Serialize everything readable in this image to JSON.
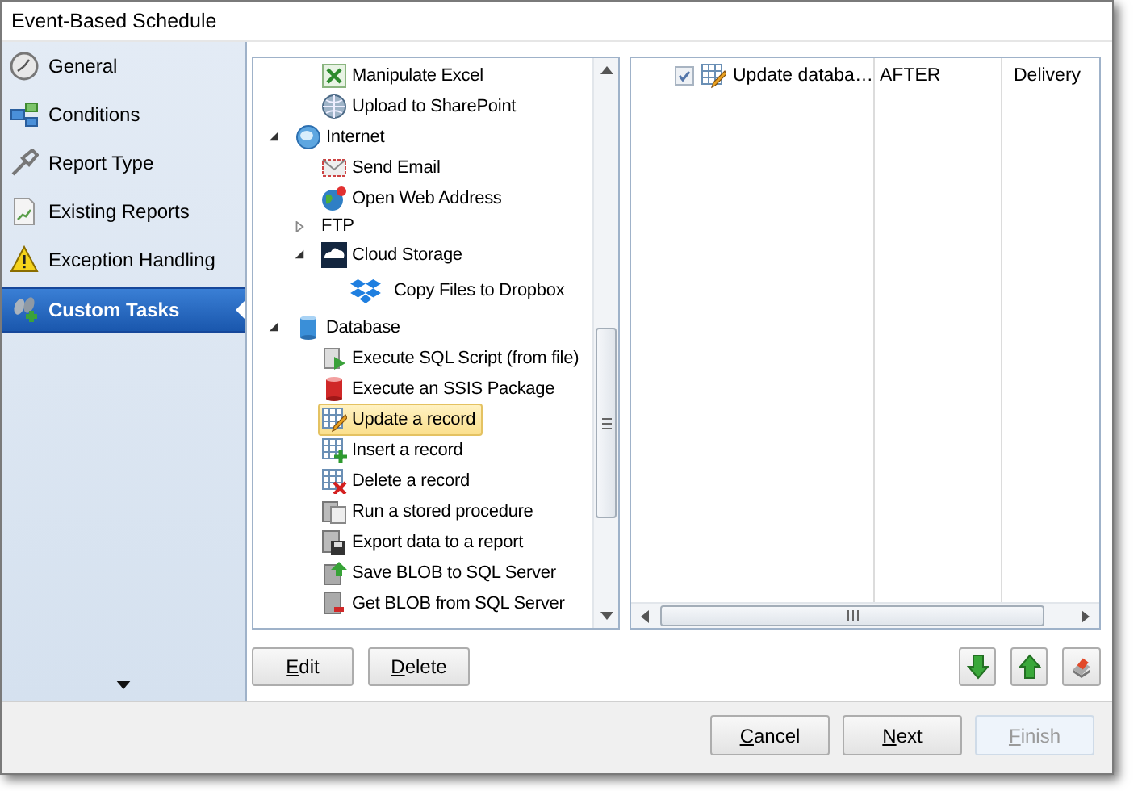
{
  "window": {
    "title": "Event-Based Schedule"
  },
  "sidebar": {
    "items": [
      {
        "label": "General",
        "kind": "clock",
        "selected": false
      },
      {
        "label": "Conditions",
        "kind": "conditions",
        "selected": false
      },
      {
        "label": "Report Type",
        "kind": "report-type",
        "selected": false
      },
      {
        "label": "Existing Reports",
        "kind": "document",
        "selected": false
      },
      {
        "label": "Exception Handling",
        "kind": "warning",
        "selected": false
      },
      {
        "label": "Custom Tasks",
        "kind": "tasks",
        "selected": true
      }
    ]
  },
  "tree": {
    "continued_items": [
      {
        "label": "Manipulate Excel",
        "kind": "excel",
        "selected": false
      },
      {
        "label": "Upload to SharePoint",
        "kind": "sharepoint",
        "selected": false
      }
    ],
    "items": [
      {
        "label": "Internet",
        "kind": "globe",
        "expanded": true,
        "selected": false,
        "children": [
          {
            "label": "Send Email",
            "kind": "mail",
            "selected": false
          },
          {
            "label": "Open Web Address",
            "kind": "web",
            "selected": false
          },
          {
            "label": "FTP",
            "kind": "plain",
            "expanded": false,
            "selected": false
          },
          {
            "label": "Cloud Storage",
            "kind": "cloud",
            "expanded": true,
            "selected": false,
            "children": [
              {
                "label": "Copy Files to Dropbox",
                "kind": "dropbox",
                "selected": false
              }
            ]
          }
        ]
      },
      {
        "label": "Database",
        "kind": "database",
        "expanded": true,
        "selected": false,
        "children": [
          {
            "label": "Execute SQL Script (from file)",
            "kind": "script",
            "selected": false
          },
          {
            "label": "Execute an SSIS Package",
            "kind": "package",
            "selected": false
          },
          {
            "label": "Update a record",
            "kind": "table-edit",
            "selected": true
          },
          {
            "label": "Insert a record",
            "kind": "table-add",
            "selected": false
          },
          {
            "label": "Delete a record",
            "kind": "table-delete",
            "selected": false
          },
          {
            "label": "Run a stored procedure",
            "kind": "procedure",
            "selected": false
          },
          {
            "label": "Export data to a report",
            "kind": "export",
            "selected": false
          },
          {
            "label": "Save BLOB to SQL Server",
            "kind": "blob-save",
            "selected": false
          },
          {
            "label": "Get BLOB from SQL Server",
            "kind": "blob-get",
            "selected": false
          }
        ]
      }
    ]
  },
  "tasks": [
    {
      "checked": true,
      "kind": "table-edit",
      "name": "Update databa…",
      "column_2": "AFTER",
      "column_3": "Delivery"
    }
  ],
  "task_buttons": [
    {
      "label": "Edit"
    },
    {
      "label": "Delete"
    }
  ],
  "footer_buttons": [
    {
      "label": "Cancel",
      "disabled": false
    },
    {
      "label": "Next",
      "disabled": false
    },
    {
      "label": "Finish",
      "disabled": true
    }
  ]
}
